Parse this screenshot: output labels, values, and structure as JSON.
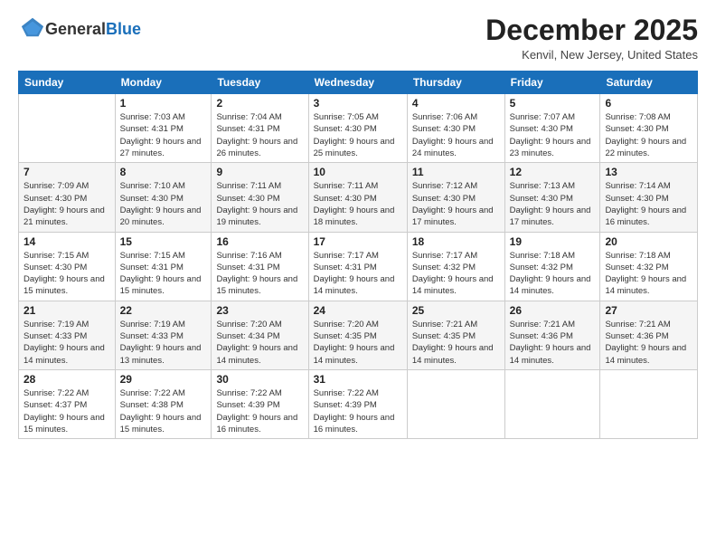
{
  "logo": {
    "general": "General",
    "blue": "Blue"
  },
  "header": {
    "month": "December 2025",
    "location": "Kenvil, New Jersey, United States"
  },
  "days_of_week": [
    "Sunday",
    "Monday",
    "Tuesday",
    "Wednesday",
    "Thursday",
    "Friday",
    "Saturday"
  ],
  "weeks": [
    [
      {
        "day": "",
        "sunrise": "",
        "sunset": "",
        "daylight": ""
      },
      {
        "day": "1",
        "sunrise": "Sunrise: 7:03 AM",
        "sunset": "Sunset: 4:31 PM",
        "daylight": "Daylight: 9 hours and 27 minutes."
      },
      {
        "day": "2",
        "sunrise": "Sunrise: 7:04 AM",
        "sunset": "Sunset: 4:31 PM",
        "daylight": "Daylight: 9 hours and 26 minutes."
      },
      {
        "day": "3",
        "sunrise": "Sunrise: 7:05 AM",
        "sunset": "Sunset: 4:30 PM",
        "daylight": "Daylight: 9 hours and 25 minutes."
      },
      {
        "day": "4",
        "sunrise": "Sunrise: 7:06 AM",
        "sunset": "Sunset: 4:30 PM",
        "daylight": "Daylight: 9 hours and 24 minutes."
      },
      {
        "day": "5",
        "sunrise": "Sunrise: 7:07 AM",
        "sunset": "Sunset: 4:30 PM",
        "daylight": "Daylight: 9 hours and 23 minutes."
      },
      {
        "day": "6",
        "sunrise": "Sunrise: 7:08 AM",
        "sunset": "Sunset: 4:30 PM",
        "daylight": "Daylight: 9 hours and 22 minutes."
      }
    ],
    [
      {
        "day": "7",
        "sunrise": "Sunrise: 7:09 AM",
        "sunset": "Sunset: 4:30 PM",
        "daylight": "Daylight: 9 hours and 21 minutes."
      },
      {
        "day": "8",
        "sunrise": "Sunrise: 7:10 AM",
        "sunset": "Sunset: 4:30 PM",
        "daylight": "Daylight: 9 hours and 20 minutes."
      },
      {
        "day": "9",
        "sunrise": "Sunrise: 7:11 AM",
        "sunset": "Sunset: 4:30 PM",
        "daylight": "Daylight: 9 hours and 19 minutes."
      },
      {
        "day": "10",
        "sunrise": "Sunrise: 7:11 AM",
        "sunset": "Sunset: 4:30 PM",
        "daylight": "Daylight: 9 hours and 18 minutes."
      },
      {
        "day": "11",
        "sunrise": "Sunrise: 7:12 AM",
        "sunset": "Sunset: 4:30 PM",
        "daylight": "Daylight: 9 hours and 17 minutes."
      },
      {
        "day": "12",
        "sunrise": "Sunrise: 7:13 AM",
        "sunset": "Sunset: 4:30 PM",
        "daylight": "Daylight: 9 hours and 17 minutes."
      },
      {
        "day": "13",
        "sunrise": "Sunrise: 7:14 AM",
        "sunset": "Sunset: 4:30 PM",
        "daylight": "Daylight: 9 hours and 16 minutes."
      }
    ],
    [
      {
        "day": "14",
        "sunrise": "Sunrise: 7:15 AM",
        "sunset": "Sunset: 4:30 PM",
        "daylight": "Daylight: 9 hours and 15 minutes."
      },
      {
        "day": "15",
        "sunrise": "Sunrise: 7:15 AM",
        "sunset": "Sunset: 4:31 PM",
        "daylight": "Daylight: 9 hours and 15 minutes."
      },
      {
        "day": "16",
        "sunrise": "Sunrise: 7:16 AM",
        "sunset": "Sunset: 4:31 PM",
        "daylight": "Daylight: 9 hours and 15 minutes."
      },
      {
        "day": "17",
        "sunrise": "Sunrise: 7:17 AM",
        "sunset": "Sunset: 4:31 PM",
        "daylight": "Daylight: 9 hours and 14 minutes."
      },
      {
        "day": "18",
        "sunrise": "Sunrise: 7:17 AM",
        "sunset": "Sunset: 4:32 PM",
        "daylight": "Daylight: 9 hours and 14 minutes."
      },
      {
        "day": "19",
        "sunrise": "Sunrise: 7:18 AM",
        "sunset": "Sunset: 4:32 PM",
        "daylight": "Daylight: 9 hours and 14 minutes."
      },
      {
        "day": "20",
        "sunrise": "Sunrise: 7:18 AM",
        "sunset": "Sunset: 4:32 PM",
        "daylight": "Daylight: 9 hours and 14 minutes."
      }
    ],
    [
      {
        "day": "21",
        "sunrise": "Sunrise: 7:19 AM",
        "sunset": "Sunset: 4:33 PM",
        "daylight": "Daylight: 9 hours and 14 minutes."
      },
      {
        "day": "22",
        "sunrise": "Sunrise: 7:19 AM",
        "sunset": "Sunset: 4:33 PM",
        "daylight": "Daylight: 9 hours and 13 minutes."
      },
      {
        "day": "23",
        "sunrise": "Sunrise: 7:20 AM",
        "sunset": "Sunset: 4:34 PM",
        "daylight": "Daylight: 9 hours and 14 minutes."
      },
      {
        "day": "24",
        "sunrise": "Sunrise: 7:20 AM",
        "sunset": "Sunset: 4:35 PM",
        "daylight": "Daylight: 9 hours and 14 minutes."
      },
      {
        "day": "25",
        "sunrise": "Sunrise: 7:21 AM",
        "sunset": "Sunset: 4:35 PM",
        "daylight": "Daylight: 9 hours and 14 minutes."
      },
      {
        "day": "26",
        "sunrise": "Sunrise: 7:21 AM",
        "sunset": "Sunset: 4:36 PM",
        "daylight": "Daylight: 9 hours and 14 minutes."
      },
      {
        "day": "27",
        "sunrise": "Sunrise: 7:21 AM",
        "sunset": "Sunset: 4:36 PM",
        "daylight": "Daylight: 9 hours and 14 minutes."
      }
    ],
    [
      {
        "day": "28",
        "sunrise": "Sunrise: 7:22 AM",
        "sunset": "Sunset: 4:37 PM",
        "daylight": "Daylight: 9 hours and 15 minutes."
      },
      {
        "day": "29",
        "sunrise": "Sunrise: 7:22 AM",
        "sunset": "Sunset: 4:38 PM",
        "daylight": "Daylight: 9 hours and 15 minutes."
      },
      {
        "day": "30",
        "sunrise": "Sunrise: 7:22 AM",
        "sunset": "Sunset: 4:39 PM",
        "daylight": "Daylight: 9 hours and 16 minutes."
      },
      {
        "day": "31",
        "sunrise": "Sunrise: 7:22 AM",
        "sunset": "Sunset: 4:39 PM",
        "daylight": "Daylight: 9 hours and 16 minutes."
      },
      {
        "day": "",
        "sunrise": "",
        "sunset": "",
        "daylight": ""
      },
      {
        "day": "",
        "sunrise": "",
        "sunset": "",
        "daylight": ""
      },
      {
        "day": "",
        "sunrise": "",
        "sunset": "",
        "daylight": ""
      }
    ]
  ]
}
